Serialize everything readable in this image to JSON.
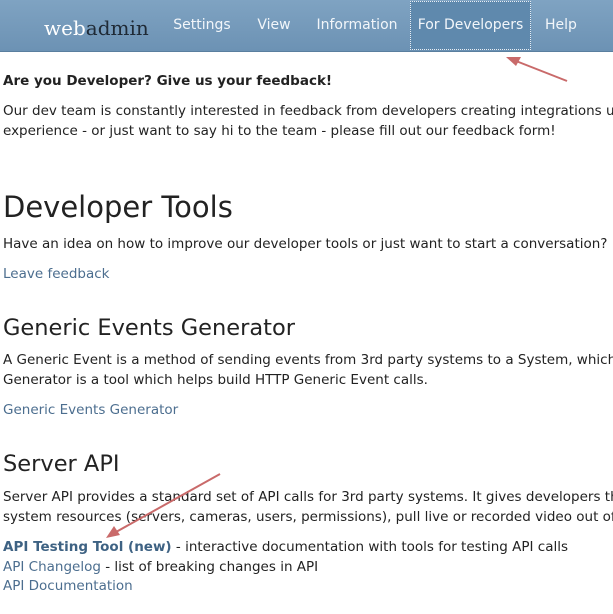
{
  "navbar": {
    "brand_part1": "web",
    "brand_part2": "admin",
    "items": [
      {
        "label": "Settings"
      },
      {
        "label": "View"
      },
      {
        "label": "Information"
      },
      {
        "label": "For Developers"
      },
      {
        "label": "Help"
      }
    ]
  },
  "intro": {
    "title": "Are you Developer? Give us your feedback!",
    "line1": "Our dev team is constantly interested in feedback from developers creating integrations using our",
    "line2": "experience - or just want to say hi to the team - please fill out our feedback form!"
  },
  "developer_tools": {
    "heading": "Developer Tools",
    "text": "Have an idea on how to improve our developer tools or just want to start a conversation?",
    "link": "Leave feedback"
  },
  "generic_events": {
    "heading": "Generic Events Generator",
    "line1": "A Generic Event is a method of sending events from 3rd party systems to a System, which can be u",
    "line2": "Generator is a tool which helps build HTTP Generic Event calls.",
    "link": "Generic Events Generator"
  },
  "server_api": {
    "heading": "Server API",
    "line1": "Server API provides a standard set of API calls for 3rd party systems. It gives developers the abilit",
    "line2": "system resources (servers, cameras, users, permissions), pull live or recorded video out of System,",
    "testing_link": "API Testing Tool (new)",
    "testing_desc": " - interactive documentation with tools for testing API calls",
    "changelog_link": "API Changelog",
    "changelog_desc": " - list of breaking changes in API",
    "docs_link": "API Documentation"
  },
  "colors": {
    "navbar": "#6c92b4",
    "link": "#4c6e8f",
    "annotation_arrow": "#c96a6a"
  }
}
